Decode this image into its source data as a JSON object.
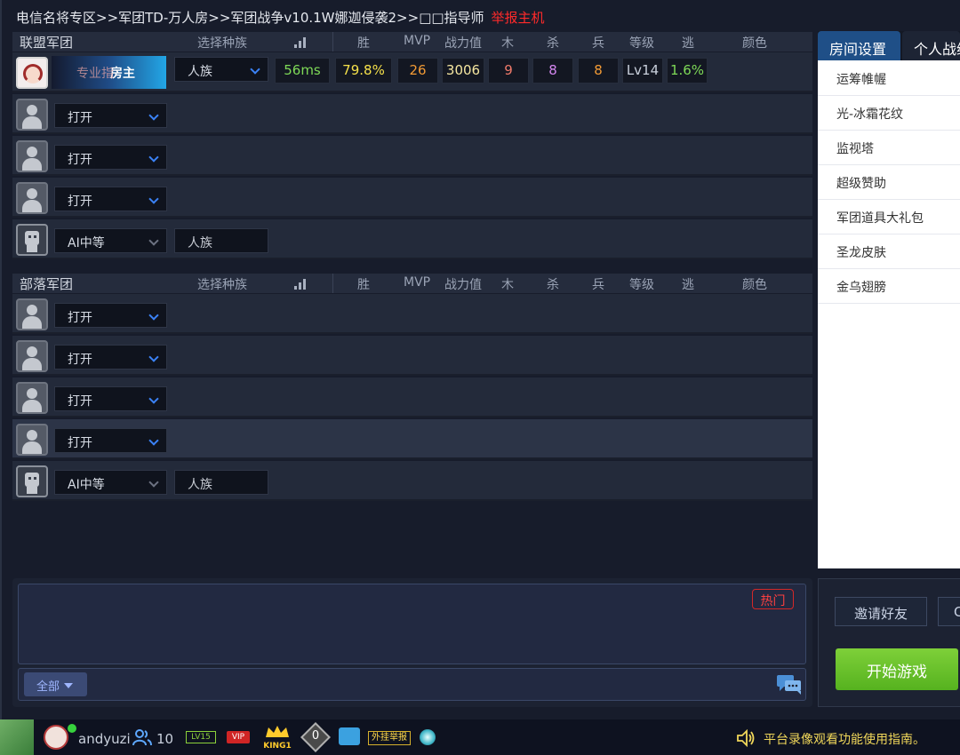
{
  "breadcrumb": {
    "path": "电信名将专区>>军团TD-万人房>>军团战争v10.1W娜迦侵袭2>>□□指导师",
    "report": "举报主机"
  },
  "columns": {
    "race": "选择种族",
    "win": "胜",
    "mvp": "MVP",
    "power": "战力值",
    "wood": "木",
    "kill": "杀",
    "soldier": "兵",
    "level": "等级",
    "escape": "逃",
    "color": "颜色"
  },
  "alliance": {
    "title": "联盟军团",
    "host": {
      "banner_faint": "专业指",
      "banner_label": "房主",
      "race": "人族",
      "ping": "56ms",
      "win_rate": "79.8%",
      "mvp": "26",
      "power": "3006",
      "wood": "9",
      "kill": "8",
      "soldier": "8",
      "level": "Lv14",
      "escape": "1.6%"
    },
    "slots": [
      {
        "status": "打开"
      },
      {
        "status": "打开"
      },
      {
        "status": "打开"
      }
    ],
    "ai": {
      "difficulty": "AI中等",
      "race": "人族"
    }
  },
  "horde": {
    "title": "部落军团",
    "slots": [
      {
        "status": "打开"
      },
      {
        "status": "打开"
      },
      {
        "status": "打开"
      },
      {
        "status": "打开"
      }
    ],
    "ai": {
      "difficulty": "AI中等",
      "race": "人族"
    }
  },
  "right_panel": {
    "tabs": [
      "房间设置",
      "个人战绩"
    ],
    "items": [
      "运筹帷幄",
      "光-冰霜花纹",
      "监视塔",
      "超级赞助",
      "军团道具大礼包",
      "圣龙皮肤",
      "金乌翅膀"
    ]
  },
  "chat": {
    "hot_label": "热门",
    "channel": "全部"
  },
  "actions": {
    "invite": "邀请好友",
    "other": "C",
    "start": "开始游戏"
  },
  "statusbar": {
    "username": "andyuzi",
    "friends": "10",
    "lv_badge": "LV15",
    "vip": "VIP",
    "king": "KING1",
    "diamond_count": "0",
    "cheat_report": "外挂举报",
    "tip": "平台录像观看功能使用指南。"
  },
  "colors": {
    "ping": "#7ed957",
    "win_rate": "#f5e04a",
    "mvp": "#f29a35",
    "power": "#f5e6a0",
    "wood": "#f07a6a",
    "kill": "#d487f0",
    "soldier": "#f29a35",
    "level": "#c9d0dc",
    "escape": "#7ed957",
    "report": "#ff2a2a",
    "start": "#6bc42e"
  }
}
